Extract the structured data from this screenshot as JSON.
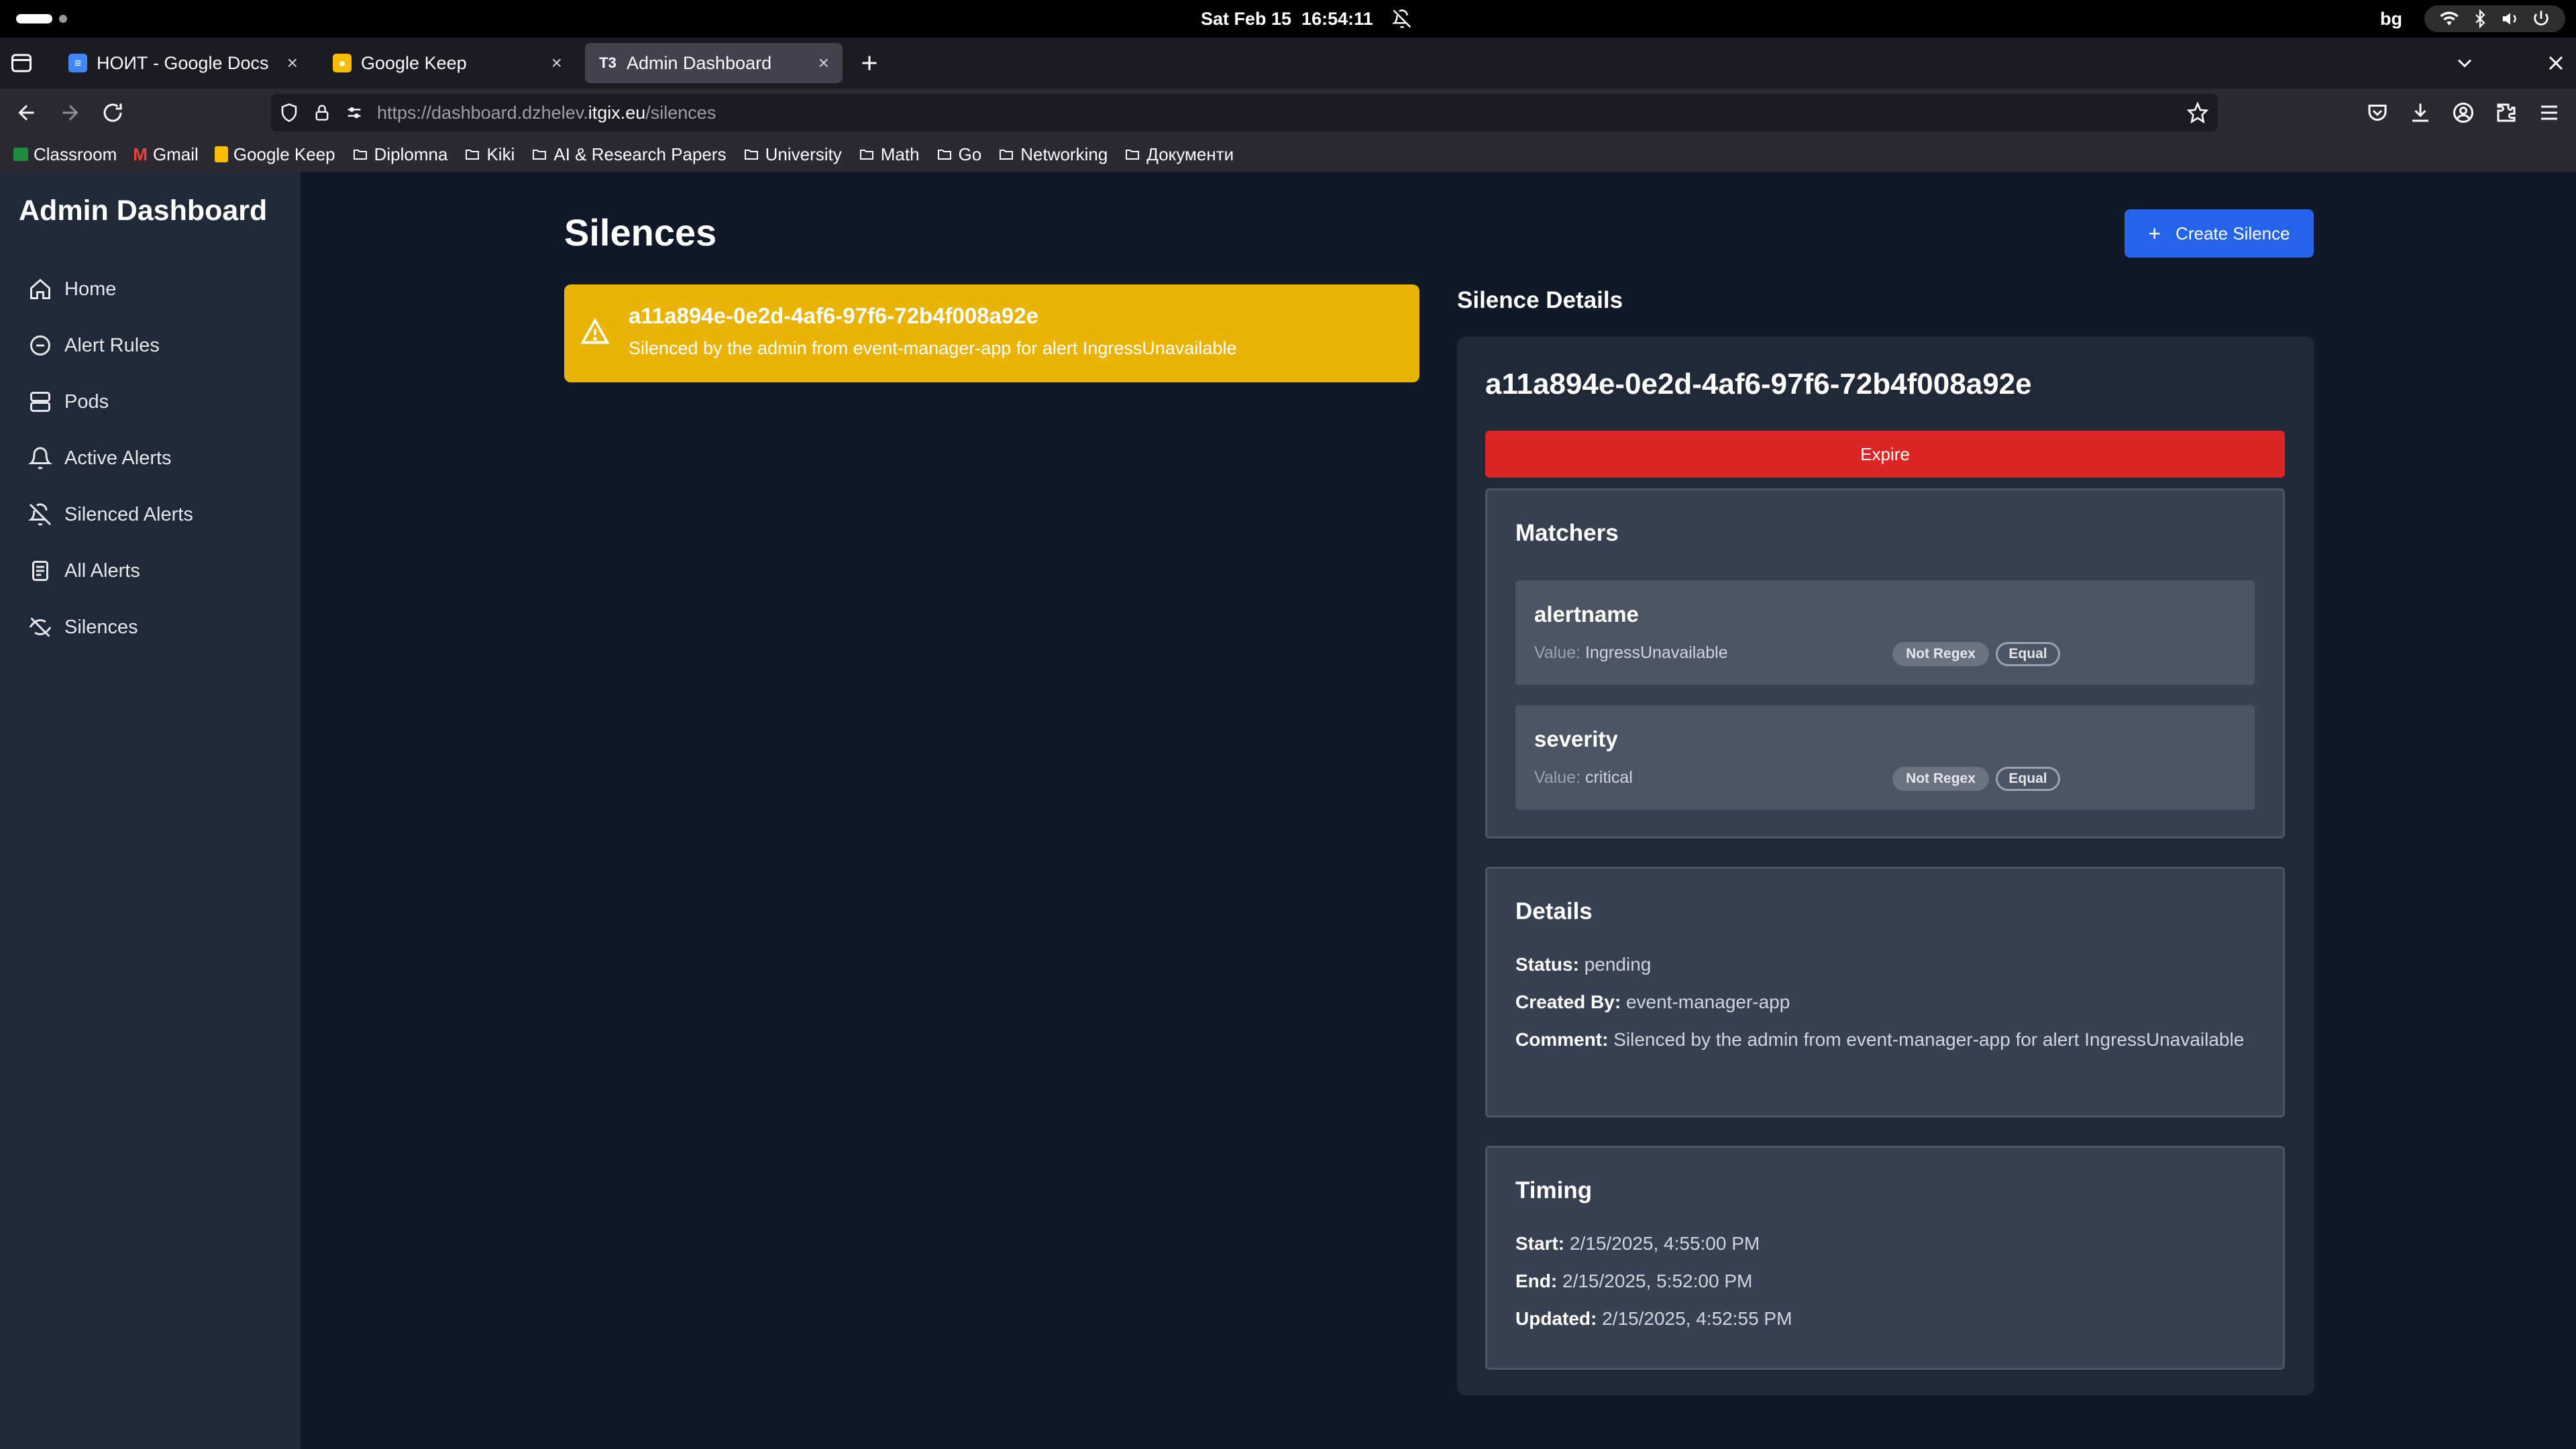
{
  "system": {
    "datetime": "Sat Feb 15  16:54:11",
    "language": "bg"
  },
  "browser": {
    "tabs": [
      {
        "title": "НОИТ - Google Docs",
        "active": false
      },
      {
        "title": "Google Keep",
        "active": false
      },
      {
        "title": "Admin Dashboard",
        "active": true
      }
    ],
    "url_prefix": "https://dashboard.dzhelev.",
    "url_host": "itgix.eu",
    "url_path": "/silences",
    "bookmarks": [
      "Classroom",
      "Gmail",
      "Google Keep",
      "Diplomna",
      "Kiki",
      "AI & Research Papers",
      "University",
      "Math",
      "Go",
      "Networking",
      "Документи"
    ]
  },
  "sidebar": {
    "title": "Admin Dashboard",
    "items": [
      {
        "label": "Home",
        "icon": "home-icon"
      },
      {
        "label": "Alert Rules",
        "icon": "minus-circle-icon"
      },
      {
        "label": "Pods",
        "icon": "server-icon"
      },
      {
        "label": "Active Alerts",
        "icon": "bell-icon"
      },
      {
        "label": "Silenced Alerts",
        "icon": "bell-off-icon"
      },
      {
        "label": "All Alerts",
        "icon": "document-icon"
      },
      {
        "label": "Silences",
        "icon": "eye-off-icon"
      }
    ]
  },
  "page": {
    "title": "Silences",
    "create_label": "Create Silence"
  },
  "silence_list": [
    {
      "id": "a11a894e-0e2d-4af6-97f6-72b4f008a92e",
      "description": "Silenced by the admin from event-manager-app for alert IngressUnavailable",
      "color": "#eab308"
    }
  ],
  "details": {
    "heading": "Silence Details",
    "id": "a11a894e-0e2d-4af6-97f6-72b4f008a92e",
    "expire_label": "Expire",
    "matchers_title": "Matchers",
    "value_label": "Value:",
    "matchers": [
      {
        "name": "alertname",
        "value": "IngressUnavailable",
        "regex": "Not Regex",
        "op": "Equal"
      },
      {
        "name": "severity",
        "value": "critical",
        "regex": "Not Regex",
        "op": "Equal"
      }
    ],
    "details_title": "Details",
    "status_key": "Status:",
    "status": "pending",
    "created_by_key": "Created By:",
    "created_by": "event-manager-app",
    "comment_key": "Comment:",
    "comment": "Silenced by the admin from event-manager-app for alert IngressUnavailable",
    "timing_title": "Timing",
    "start_key": "Start:",
    "start": "2/15/2025, 4:55:00 PM",
    "end_key": "End:",
    "end": "2/15/2025, 5:52:00 PM",
    "updated_key": "Updated:",
    "updated": "2/15/2025, 4:52:55 PM"
  },
  "colors": {
    "accent": "#2563eb",
    "danger": "#dc2626",
    "warning": "#eab308",
    "bg": "#111827",
    "panel": "#1f2937"
  }
}
